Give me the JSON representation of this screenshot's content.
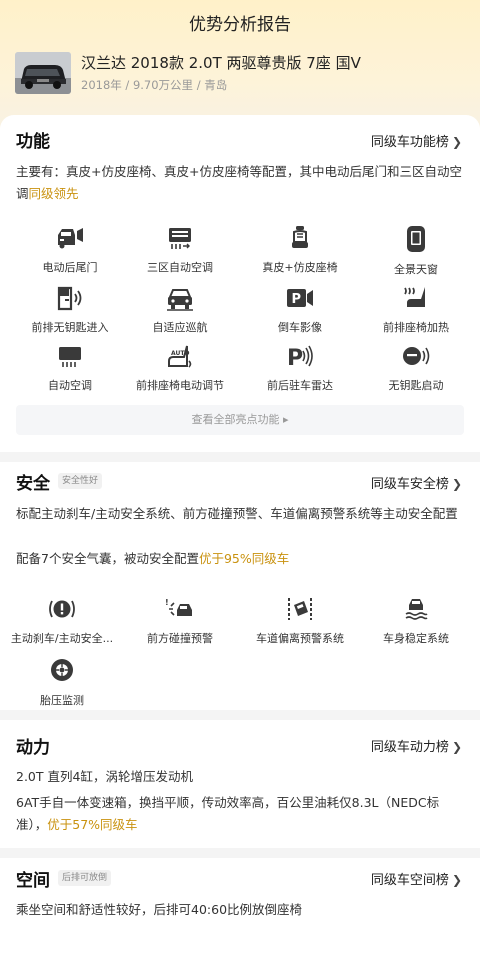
{
  "header": {
    "title": "优势分析报告",
    "car_name": "汉兰达 2018款 2.0T 两驱尊贵版 7座 国V",
    "car_meta": "2018年 / 9.70万公里 / 青岛"
  },
  "function": {
    "title": "功能",
    "link": "同级车功能榜",
    "summary_prefix": "主要有：真皮+仿皮座椅、真皮+仿皮座椅等配置，其中电动后尾门和三区自动空调",
    "summary_highlight": "同级领先",
    "see_all": "查看全部亮点功能 ▸",
    "features": [
      {
        "label": "电动后尾门",
        "icon": "power-tailgate-icon"
      },
      {
        "label": "三区自动空调",
        "icon": "climate-control-icon"
      },
      {
        "label": "真皮+仿皮座椅",
        "icon": "leather-seat-icon"
      },
      {
        "label": "全景天窗",
        "icon": "panoramic-sunroof-icon"
      },
      {
        "label": "前排无钥匙进入",
        "icon": "keyless-entry-icon"
      },
      {
        "label": "自适应巡航",
        "icon": "adaptive-cruise-icon"
      },
      {
        "label": "倒车影像",
        "icon": "reverse-camera-icon"
      },
      {
        "label": "前排座椅加热",
        "icon": "seat-heating-icon"
      },
      {
        "label": "自动空调",
        "icon": "auto-ac-icon"
      },
      {
        "label": "前排座椅电动调节",
        "icon": "power-seat-icon"
      },
      {
        "label": "前后驻车雷达",
        "icon": "parking-radar-icon"
      },
      {
        "label": "无钥匙启动",
        "icon": "keyless-start-icon"
      }
    ]
  },
  "safety": {
    "title": "安全",
    "tag": "安全性好",
    "link": "同级车安全榜",
    "line1": "标配主动刹车/主动安全系统、前方碰撞预警、车道偏离预警系统等主动安全配置",
    "line2_prefix": "配备7个安全气囊，被动安全配置",
    "line2_highlight": "优于95%同级车",
    "features": [
      {
        "label": "主动刹车/主动安全...",
        "icon": "active-brake-icon"
      },
      {
        "label": "前方碰撞预警",
        "icon": "collision-warning-icon"
      },
      {
        "label": "车道偏离预警系统",
        "icon": "lane-departure-icon"
      },
      {
        "label": "车身稳定系统",
        "icon": "stability-control-icon"
      },
      {
        "label": "胎压监测",
        "icon": "tire-pressure-icon"
      }
    ]
  },
  "power": {
    "title": "动力",
    "link": "同级车动力榜",
    "line1": "2.0T 直列4缸，涡轮增压发动机",
    "line2_prefix": "6AT手自一体变速箱，换挡平顺，传动效率高，百公里油耗仅8.3L（NEDC标准），",
    "line2_highlight": "优于57%同级车"
  },
  "space": {
    "title": "空间",
    "tag": "后排可放倒",
    "link": "同级车空间榜",
    "line1": "乘坐空间和舒适性较好，后排可40:60比例放倒座椅"
  },
  "colors": {
    "highlight": "#c9920f",
    "header_gradient_top": "#fff1c9"
  }
}
